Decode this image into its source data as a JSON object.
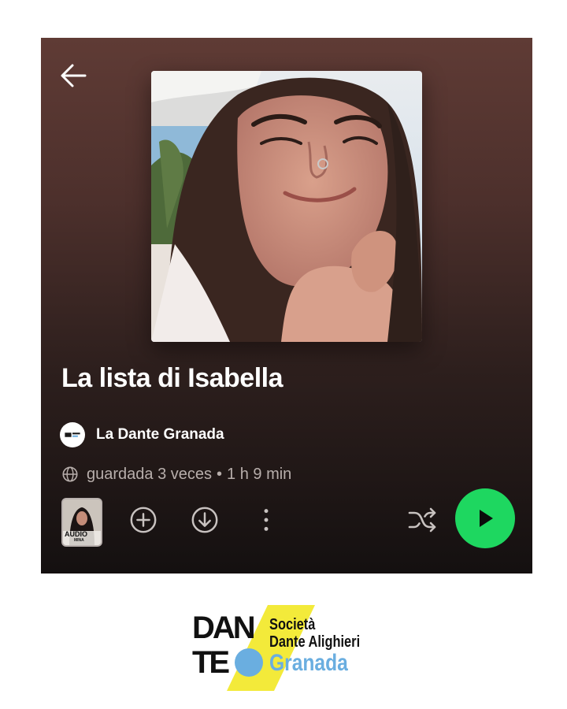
{
  "playlist": {
    "title": "La lista di Isabella",
    "owner_name": "La Dante Granada",
    "saves_text": "guardada 3 veces",
    "separator": "•",
    "duration": "1 h 9 min",
    "cover_alt": "selfie-photo",
    "thumb_label": "AUDIO",
    "thumb_sub": "MINA"
  },
  "icons": {
    "back": "arrow-left-icon",
    "globe": "globe-icon",
    "add": "plus-circle-icon",
    "download": "download-circle-icon",
    "more": "more-vertical-icon",
    "shuffle": "shuffle-icon",
    "play": "play-icon"
  },
  "colors": {
    "accent_play": "#1ed760",
    "header_top": "#5f3b35",
    "header_bottom": "#141010",
    "logo_blue": "#6aaee0",
    "logo_yellow": "#f3ea3a"
  },
  "footer_logo": {
    "mark_top": "DAN",
    "mark_bottom": "TE",
    "line1": "Società",
    "line2": "Dante Alighieri",
    "line3": "Granada"
  }
}
